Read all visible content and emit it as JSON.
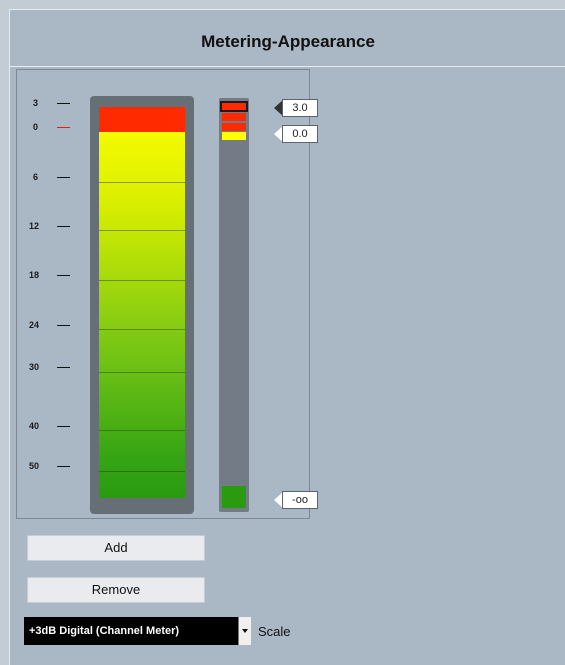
{
  "window": {
    "title": "Metering-Appearance"
  },
  "scale_ticks": [
    {
      "label": "3",
      "db": 3,
      "highlight": false
    },
    {
      "label": "0",
      "db": 0,
      "highlight": true
    },
    {
      "label": "6",
      "db": 6,
      "highlight": false
    },
    {
      "label": "12",
      "db": 12,
      "highlight": false
    },
    {
      "label": "18",
      "db": 18,
      "highlight": false
    },
    {
      "label": "24",
      "db": 24,
      "highlight": false
    },
    {
      "label": "30",
      "db": 30,
      "highlight": false
    },
    {
      "label": "40",
      "db": 40,
      "highlight": false
    },
    {
      "label": "50",
      "db": 50,
      "highlight": false
    }
  ],
  "color_handles": [
    {
      "label": "3.0",
      "color": "#ff2a00",
      "selected": true
    },
    {
      "label": "0.0",
      "color": "#ffff00",
      "selected": false
    },
    {
      "label": "-oo",
      "color": "#2a9a10",
      "selected": false
    }
  ],
  "colors": {
    "clip": "#ff2a00",
    "high": "#ffff00",
    "low": "#2a9a10",
    "panel": "#aab7c5"
  },
  "buttons": {
    "add_label": "Add",
    "remove_label": "Remove"
  },
  "scale": {
    "selected": "+3dB Digital (Channel Meter)",
    "label": "Scale"
  }
}
